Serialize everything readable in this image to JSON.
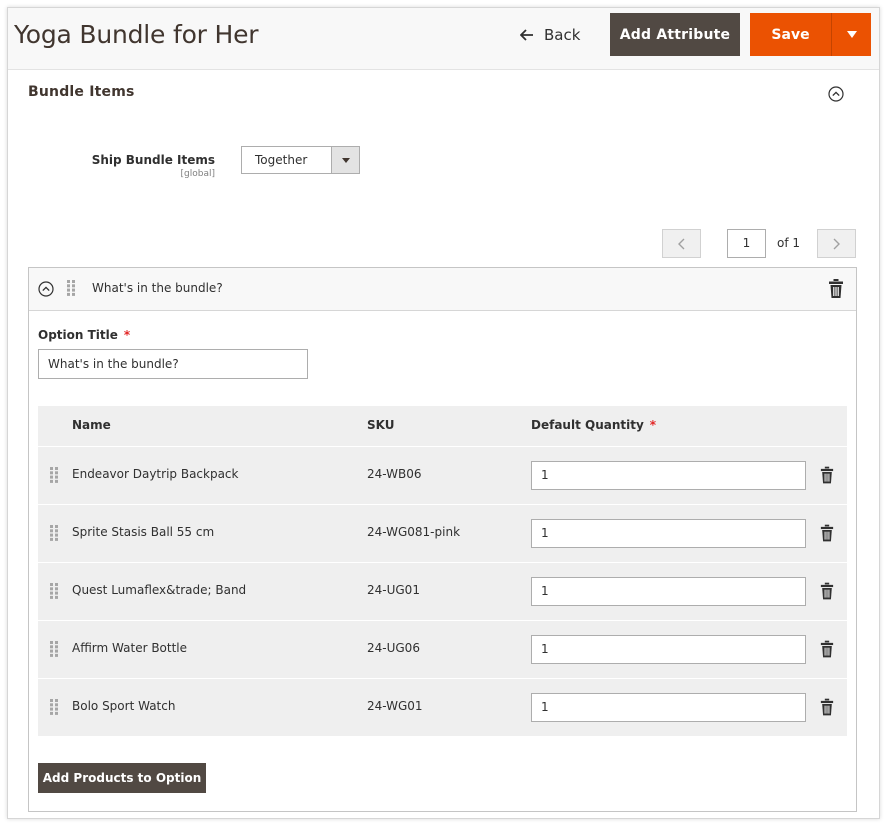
{
  "header": {
    "title": "Yoga Bundle for Her",
    "back_label": "Back",
    "add_attribute_label": "Add Attribute",
    "save_label": "Save"
  },
  "section": {
    "title": "Bundle Items"
  },
  "ship_bundle": {
    "label": "Ship Bundle Items",
    "scope": "[global]",
    "value": "Together"
  },
  "pager": {
    "current": "1",
    "of_label": "of 1"
  },
  "option": {
    "header_title": "What's in the bundle?",
    "title_label": "Option Title",
    "required_mark": "*",
    "title_value": "What's in the bundle?",
    "columns": {
      "name": "Name",
      "sku": "SKU",
      "qty": "Default Quantity",
      "qty_required": "*"
    },
    "rows": [
      {
        "name": "Endeavor Daytrip Backpack",
        "sku": "24-WB06",
        "qty": "1"
      },
      {
        "name": "Sprite Stasis Ball 55 cm",
        "sku": "24-WG081-pink",
        "qty": "1"
      },
      {
        "name": "Quest Lumaflex&trade; Band",
        "sku": "24-UG01",
        "qty": "1"
      },
      {
        "name": "Affirm Water Bottle",
        "sku": "24-UG06",
        "qty": "1"
      },
      {
        "name": "Bolo Sport Watch",
        "sku": "24-WG01",
        "qty": "1"
      }
    ],
    "add_products_label": "Add Products to Option"
  },
  "icons": {
    "back": "arrow-left-icon",
    "save_toggle": "caret-down-icon",
    "collapse": "chevron-up-circle-icon",
    "drag": "drag-handle-icon",
    "delete": "trash-icon",
    "prev": "chevron-left-icon",
    "next": "chevron-right-icon"
  },
  "colors": {
    "primary": "#eb5202",
    "secondary": "#514943",
    "required": "#e22626"
  }
}
